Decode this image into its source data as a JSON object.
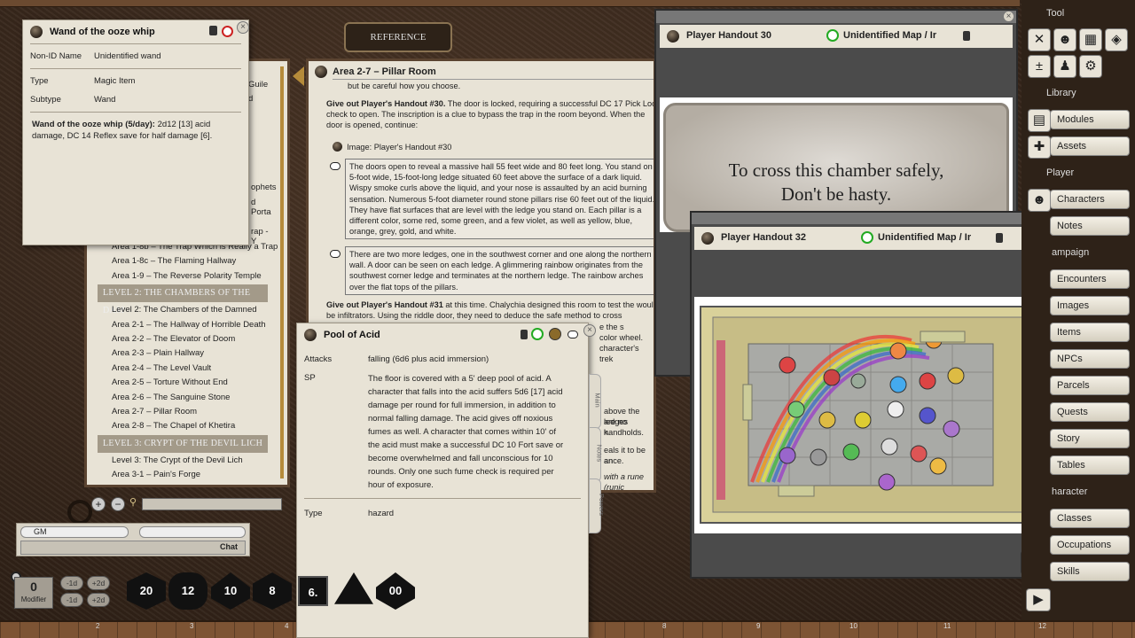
{
  "reference_button": "REFERENCE",
  "wand": {
    "title": "Wand of the ooze whip",
    "nonid_label": "Non-ID Name",
    "nonid_value": "Unidentified wand",
    "type_label": "Type",
    "type_value": "Magic Item",
    "subtype_label": "Subtype",
    "subtype_value": "Wand",
    "desc_bold": "Wand of the ooze whip (5/day):",
    "desc_rest": " 2d12 [13] acid damage, DC 14 Reflex save for half damage [6]."
  },
  "story": {
    "partial": [
      "Guile",
      "d",
      "ophets",
      "d Porta",
      "rap - Y"
    ],
    "items1": [
      "Area 1-8b – The Trap Which is Really a Trap",
      "Area 1-8c – The Flaming Hallway",
      "Area 1-9 – The Reverse Polarity Temple"
    ],
    "level2": "LEVEL 2: THE CHAMBERS OF THE DAM",
    "items2": [
      "Level 2: The Chambers of the Damned",
      "Area 2-1 – The Hallway of Horrible Death",
      "Area 2-2 – The Elevator of Doom",
      "Area 2-3 – Plain Hallway",
      "Area 2-4 – The Level Vault",
      "Area 2-5 – Torture Without End",
      "Area 2-6 – The Sanguine Stone",
      "Area 2-7 – Pillar Room",
      "Area 2-8 – The Chapel of Khetira"
    ],
    "level3": "LEVEL 3: CRYPT OF THE DEVIL LICH",
    "items3": [
      "Level 3: The Crypt of the Devil Lich",
      "Area 3-1 – Pain's Forge"
    ]
  },
  "pillar": {
    "title": "Area 2-7 – Pillar Room",
    "line0": "but be careful how you choose.",
    "p1_bold": "Give out Player's Handout #30.",
    "p1_rest": " The door is locked, requiring a successful DC 17 Pick Lock check to open. The inscription is a clue to bypass the trap in the room beyond. When the door is opened, continue:",
    "image_link": "Image: Player's Handout #30",
    "box1": "The doors open to reveal a massive hall 55 feet wide and 80 feet long. You stand on a 5-foot wide, 15-foot-long ledge situated 60 feet above the surface of a dark liquid. Wispy smoke curls above the liquid, and your nose is assaulted by an acid burning sensation. Numerous 5-foot diameter round stone pillars rise 60 feet out of the liquid. They have flat surfaces that are level with the ledge you stand on. Each pillar is a different color, some red, some green, and a few violet, as well as yellow, blue, orange, grey, gold, and white.",
    "box2": "There are two more ledges, one in the southwest corner and one along the northern wall. A door can be seen on each ledge. A glimmering rainbow originates from the southwest corner ledge and terminates at the northern ledge. The rainbow arches over the flat tops of the pillars.",
    "p2_bold": "Give out Player's Handout #31",
    "p2_rest": " at this time. Chalychia designed this room to test the would-be infiltrators. Using the riddle door, they need to deduce the safe method to cross",
    "frag": [
      "e the s",
      "color wheel.",
      "character's trek",
      "",
      "",
      "above the ledges",
      "are no handholds.",
      "k.",
      "",
      "eals it to be an",
      "ance.",
      "",
      "with a rune (runic"
    ]
  },
  "acid": {
    "title": "Pool of Acid",
    "attacks_label": "Attacks",
    "attacks_value": "falling (6d6 plus acid immersion)",
    "sp_label": "SP",
    "sp_value": "The floor is covered with a 5' deep pool of acid. A character that falls into the acid suffers 5d6 [17] acid damage per round for full immersion, in addition to normal falling damage. The acid gives off noxious fumes as well. A character that comes within 10' of the acid must make a successful DC 10 Fort save or become overwhelmed and fall unconscious for 10 rounds. Only one such fume check is required per hour of exposure.",
    "type_label": "Type",
    "type_value": "hazard",
    "tabs": [
      "Main",
      "Notes",
      "Powers"
    ]
  },
  "h30": {
    "title": "Player Handout 30",
    "map_label": "Unidentified Map / Ir",
    "line1": "To cross this chamber safely,",
    "line2": "Don't be hasty."
  },
  "h32": {
    "title": "Player Handout 32",
    "map_label": "Unidentified Map / Ir"
  },
  "chat": {
    "speaker": "GM",
    "button": "Chat"
  },
  "modifier": {
    "value": "0",
    "label": "Modifier",
    "buttons": [
      "-1d",
      "+2d",
      "-1d",
      "+2d"
    ]
  },
  "dice": [
    "20",
    "12",
    "10",
    "8",
    "6.",
    "",
    "00"
  ],
  "ruler": [
    "1",
    "2",
    "3",
    "4",
    "8",
    "9",
    "10",
    "11",
    "12"
  ],
  "sidebar": {
    "tool": "Tool",
    "library": "Library",
    "player": "Player",
    "modules": "Modules",
    "assets": "Assets",
    "characters": "Characters",
    "notes": "Notes",
    "campaign": "ampaign",
    "encounters": "Encounters",
    "images": "Images",
    "items": "Items",
    "npcs": "NPCs",
    "parcels": "Parcels",
    "quests": "Quests",
    "story": "Story",
    "tables": "Tables",
    "character": "haracter",
    "classes": "Classes",
    "occupations": "Occupations",
    "skills": "Skills"
  }
}
